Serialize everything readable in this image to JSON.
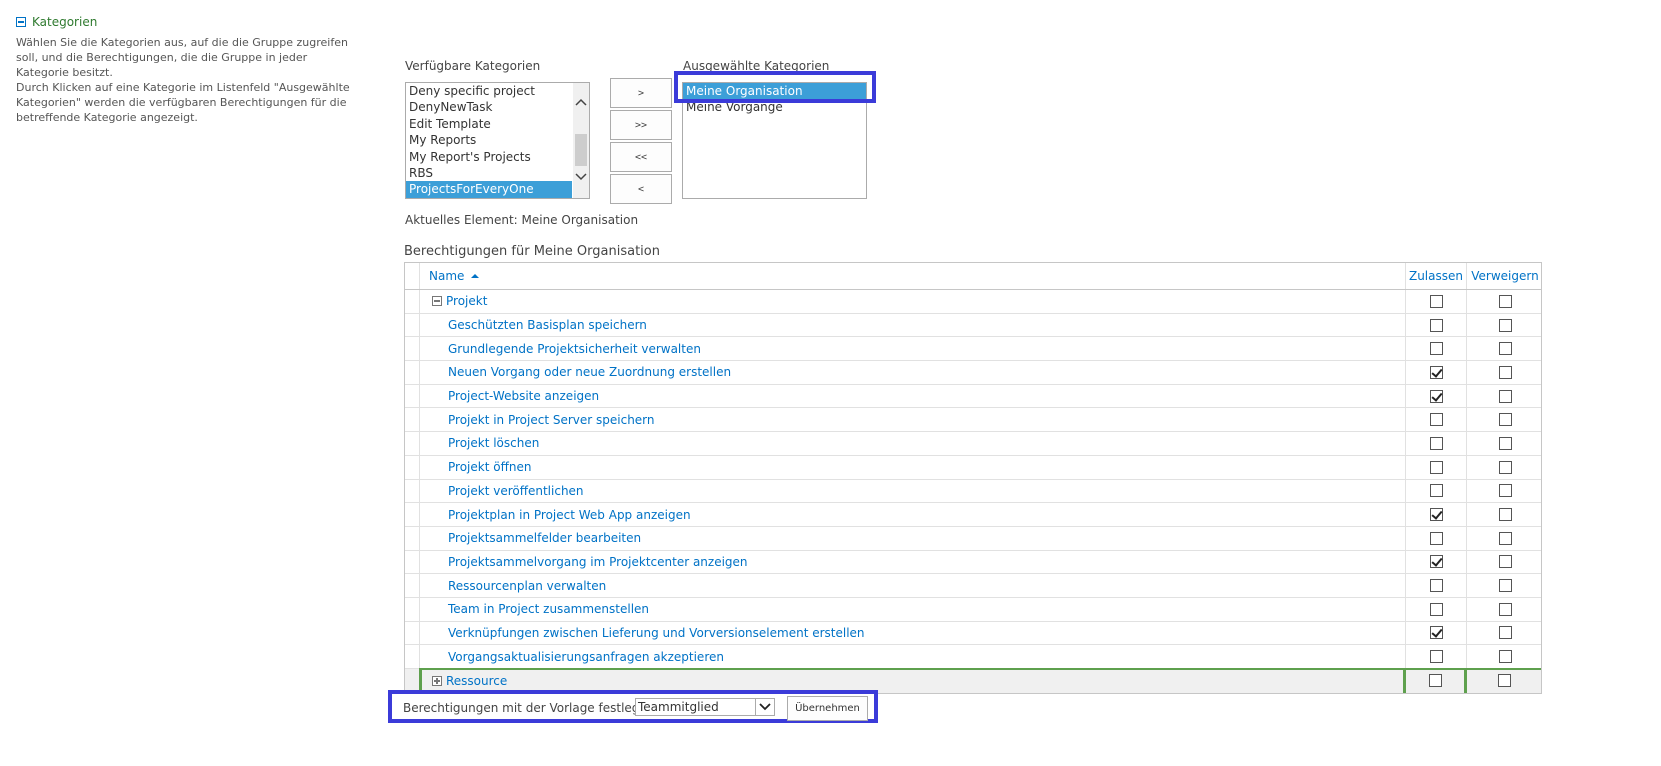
{
  "section": {
    "title": "Kategorien",
    "desc1": "Wählen Sie die Kategorien aus, auf die die Gruppe zugreifen soll, und die Berechtigungen, die die Gruppe in jeder Kategorie besitzt.",
    "desc2": "Durch Klicken auf eine Kategorie im Listenfeld \"Ausgewählte Kategorien\" werden die verfügbaren Berechtigungen für die betreffende Kategorie angezeigt."
  },
  "available": {
    "label": "Verfügbare Kategorien",
    "items": [
      "Deny specific project",
      "DenyNewTask",
      "Edit Template",
      "My Reports",
      "My Report's Projects",
      "RBS",
      "ProjectsForEveryOne"
    ],
    "selected_index": 6
  },
  "move_buttons": [
    ">",
    ">>",
    "<<",
    "<"
  ],
  "selected": {
    "label": "Ausgewählte Kategorien",
    "items": [
      "Meine Organisation",
      "Meine Vorgänge"
    ],
    "selected_index": 0
  },
  "current_element": "Aktuelles Element: Meine Organisation",
  "permissions": {
    "title": "Berechtigungen für Meine Organisation",
    "columns": {
      "name": "Name",
      "allow": "Zulassen",
      "deny": "Verweigern"
    },
    "group": "Projekt",
    "rows": [
      {
        "name": "Geschützten Basisplan speichern",
        "allow": false,
        "deny": false
      },
      {
        "name": "Grundlegende Projektsicherheit verwalten",
        "allow": false,
        "deny": false
      },
      {
        "name": "Neuen Vorgang oder neue Zuordnung erstellen",
        "allow": true,
        "deny": false
      },
      {
        "name": "Project-Website anzeigen",
        "allow": true,
        "deny": false
      },
      {
        "name": "Projekt in Project Server speichern",
        "allow": false,
        "deny": false
      },
      {
        "name": "Projekt löschen",
        "allow": false,
        "deny": false
      },
      {
        "name": "Projekt öffnen",
        "allow": false,
        "deny": false
      },
      {
        "name": "Projekt veröffentlichen",
        "allow": false,
        "deny": false
      },
      {
        "name": "Projektplan in Project Web App anzeigen",
        "allow": true,
        "deny": false
      },
      {
        "name": "Projektsammelfelder bearbeiten",
        "allow": false,
        "deny": false
      },
      {
        "name": "Projektsammelvorgang im Projektcenter anzeigen",
        "allow": true,
        "deny": false
      },
      {
        "name": "Ressourcenplan verwalten",
        "allow": false,
        "deny": false
      },
      {
        "name": "Team in Project zusammenstellen",
        "allow": false,
        "deny": false
      },
      {
        "name": "Verknüpfungen zwischen Lieferung und Vorversionselement erstellen",
        "allow": true,
        "deny": false
      },
      {
        "name": "Vorgangsaktualisierungsanfragen akzeptieren",
        "allow": false,
        "deny": false
      }
    ],
    "collapsed_group": "Ressource"
  },
  "template": {
    "label": "Berechtigungen mit der Vorlage festlegen:",
    "value": "Teammitglied",
    "apply": "Übernehmen"
  },
  "colors": {
    "link": "#0072c6",
    "section_title": "#2f7a2f",
    "selection": "#3c9fd8",
    "highlight": "#3b3bd9",
    "group_accent": "#5ea04d"
  }
}
